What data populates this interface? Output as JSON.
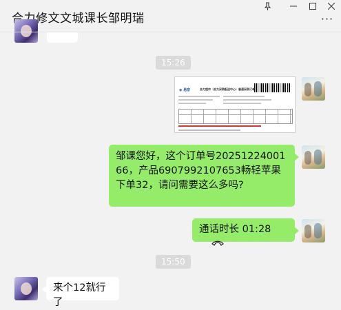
{
  "window": {
    "title": "合力修文文城课长邹明瑞",
    "pin_icon": "pin-icon",
    "minimize_icon": "minimize-icon",
    "maximize_icon": "maximize-icon",
    "close_icon": "close-icon",
    "more_icon": "more-icon"
  },
  "messages": {
    "time1": "15:26",
    "image_message": {
      "logo_text": "◉ 易京",
      "heading": "合力超市（合力采购配送中心）普通采购订单"
    },
    "text_message": "邹课您好，这个订单号2025122400166，产品6907992107653畅轻苹果下单32，请问需要这么多吗?",
    "call_message": "通话时长 01:28",
    "time2": "15:50",
    "reply_message": "来个12就行了"
  },
  "colors": {
    "background": "#f2f2f2",
    "self_bubble": "#95ec69",
    "other_bubble": "#ffffff",
    "time_badge": "#dadada"
  }
}
